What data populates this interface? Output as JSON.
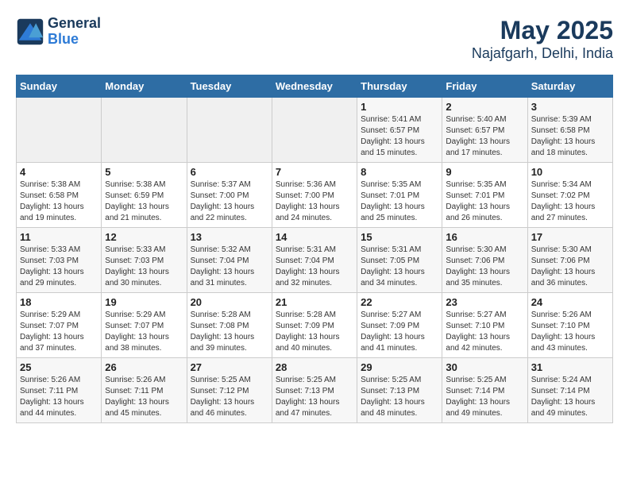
{
  "app": {
    "logo_line1": "General",
    "logo_line2": "Blue"
  },
  "title": "May 2025",
  "subtitle": "Najafgarh, Delhi, India",
  "days_of_week": [
    "Sunday",
    "Monday",
    "Tuesday",
    "Wednesday",
    "Thursday",
    "Friday",
    "Saturday"
  ],
  "weeks": [
    [
      {
        "day": "",
        "info": ""
      },
      {
        "day": "",
        "info": ""
      },
      {
        "day": "",
        "info": ""
      },
      {
        "day": "",
        "info": ""
      },
      {
        "day": "1",
        "info": "Sunrise: 5:41 AM\nSunset: 6:57 PM\nDaylight: 13 hours and 15 minutes."
      },
      {
        "day": "2",
        "info": "Sunrise: 5:40 AM\nSunset: 6:57 PM\nDaylight: 13 hours and 17 minutes."
      },
      {
        "day": "3",
        "info": "Sunrise: 5:39 AM\nSunset: 6:58 PM\nDaylight: 13 hours and 18 minutes."
      }
    ],
    [
      {
        "day": "4",
        "info": "Sunrise: 5:38 AM\nSunset: 6:58 PM\nDaylight: 13 hours and 19 minutes."
      },
      {
        "day": "5",
        "info": "Sunrise: 5:38 AM\nSunset: 6:59 PM\nDaylight: 13 hours and 21 minutes."
      },
      {
        "day": "6",
        "info": "Sunrise: 5:37 AM\nSunset: 7:00 PM\nDaylight: 13 hours and 22 minutes."
      },
      {
        "day": "7",
        "info": "Sunrise: 5:36 AM\nSunset: 7:00 PM\nDaylight: 13 hours and 24 minutes."
      },
      {
        "day": "8",
        "info": "Sunrise: 5:35 AM\nSunset: 7:01 PM\nDaylight: 13 hours and 25 minutes."
      },
      {
        "day": "9",
        "info": "Sunrise: 5:35 AM\nSunset: 7:01 PM\nDaylight: 13 hours and 26 minutes."
      },
      {
        "day": "10",
        "info": "Sunrise: 5:34 AM\nSunset: 7:02 PM\nDaylight: 13 hours and 27 minutes."
      }
    ],
    [
      {
        "day": "11",
        "info": "Sunrise: 5:33 AM\nSunset: 7:03 PM\nDaylight: 13 hours and 29 minutes."
      },
      {
        "day": "12",
        "info": "Sunrise: 5:33 AM\nSunset: 7:03 PM\nDaylight: 13 hours and 30 minutes."
      },
      {
        "day": "13",
        "info": "Sunrise: 5:32 AM\nSunset: 7:04 PM\nDaylight: 13 hours and 31 minutes."
      },
      {
        "day": "14",
        "info": "Sunrise: 5:31 AM\nSunset: 7:04 PM\nDaylight: 13 hours and 32 minutes."
      },
      {
        "day": "15",
        "info": "Sunrise: 5:31 AM\nSunset: 7:05 PM\nDaylight: 13 hours and 34 minutes."
      },
      {
        "day": "16",
        "info": "Sunrise: 5:30 AM\nSunset: 7:06 PM\nDaylight: 13 hours and 35 minutes."
      },
      {
        "day": "17",
        "info": "Sunrise: 5:30 AM\nSunset: 7:06 PM\nDaylight: 13 hours and 36 minutes."
      }
    ],
    [
      {
        "day": "18",
        "info": "Sunrise: 5:29 AM\nSunset: 7:07 PM\nDaylight: 13 hours and 37 minutes."
      },
      {
        "day": "19",
        "info": "Sunrise: 5:29 AM\nSunset: 7:07 PM\nDaylight: 13 hours and 38 minutes."
      },
      {
        "day": "20",
        "info": "Sunrise: 5:28 AM\nSunset: 7:08 PM\nDaylight: 13 hours and 39 minutes."
      },
      {
        "day": "21",
        "info": "Sunrise: 5:28 AM\nSunset: 7:09 PM\nDaylight: 13 hours and 40 minutes."
      },
      {
        "day": "22",
        "info": "Sunrise: 5:27 AM\nSunset: 7:09 PM\nDaylight: 13 hours and 41 minutes."
      },
      {
        "day": "23",
        "info": "Sunrise: 5:27 AM\nSunset: 7:10 PM\nDaylight: 13 hours and 42 minutes."
      },
      {
        "day": "24",
        "info": "Sunrise: 5:26 AM\nSunset: 7:10 PM\nDaylight: 13 hours and 43 minutes."
      }
    ],
    [
      {
        "day": "25",
        "info": "Sunrise: 5:26 AM\nSunset: 7:11 PM\nDaylight: 13 hours and 44 minutes."
      },
      {
        "day": "26",
        "info": "Sunrise: 5:26 AM\nSunset: 7:11 PM\nDaylight: 13 hours and 45 minutes."
      },
      {
        "day": "27",
        "info": "Sunrise: 5:25 AM\nSunset: 7:12 PM\nDaylight: 13 hours and 46 minutes."
      },
      {
        "day": "28",
        "info": "Sunrise: 5:25 AM\nSunset: 7:13 PM\nDaylight: 13 hours and 47 minutes."
      },
      {
        "day": "29",
        "info": "Sunrise: 5:25 AM\nSunset: 7:13 PM\nDaylight: 13 hours and 48 minutes."
      },
      {
        "day": "30",
        "info": "Sunrise: 5:25 AM\nSunset: 7:14 PM\nDaylight: 13 hours and 49 minutes."
      },
      {
        "day": "31",
        "info": "Sunrise: 5:24 AM\nSunset: 7:14 PM\nDaylight: 13 hours and 49 minutes."
      }
    ]
  ]
}
